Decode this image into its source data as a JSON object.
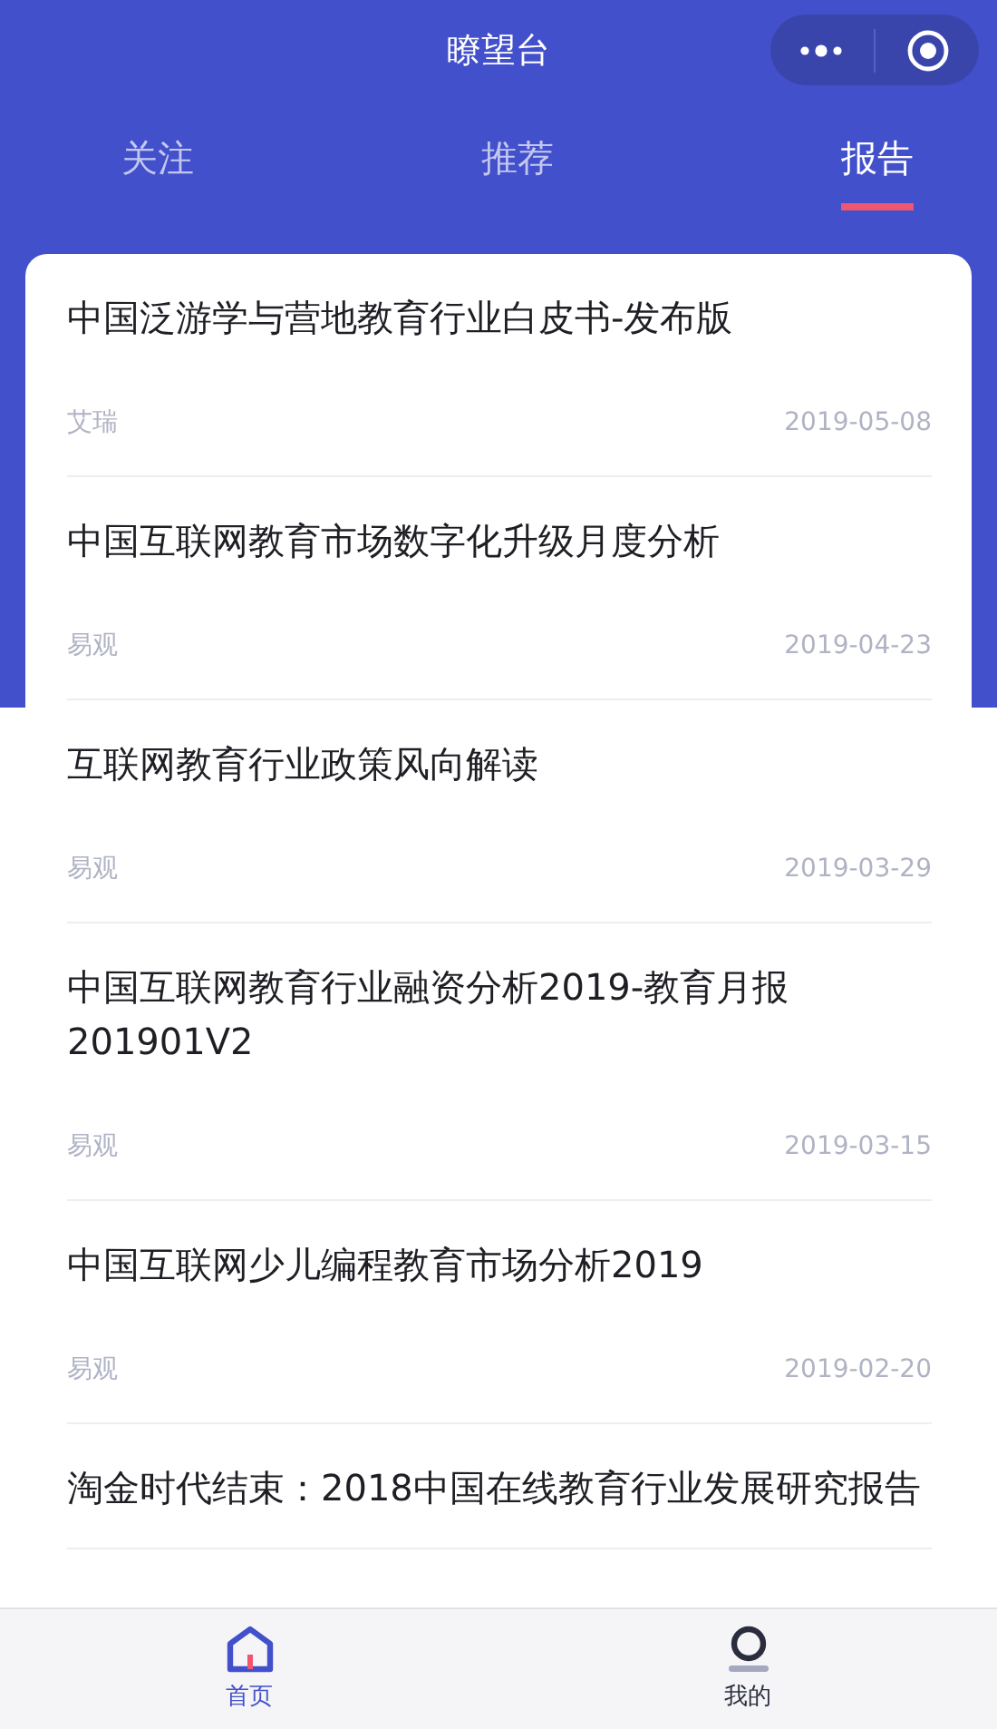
{
  "window": {
    "title": "瞭望台"
  },
  "tabs": [
    {
      "label": "关注",
      "selected": false
    },
    {
      "label": "推荐",
      "selected": false
    },
    {
      "label": "报告",
      "selected": true
    }
  ],
  "reports": [
    {
      "title": "中国泛游学与营地教育行业白皮书-发布版",
      "source": "艾瑞",
      "date": "2019-05-08"
    },
    {
      "title": "中国互联网教育市场数字化升级月度分析",
      "source": "易观",
      "date": "2019-04-23"
    },
    {
      "title": "互联网教育行业政策风向解读",
      "source": "易观",
      "date": "2019-03-29"
    },
    {
      "title": "中国互联网教育行业融资分析2019-教育月报201901V2",
      "source": "易观",
      "date": "2019-03-15"
    },
    {
      "title": "中国互联网少儿编程教育市场分析2019",
      "source": "易观",
      "date": "2019-02-20"
    },
    {
      "title": "淘金时代结束：2018中国在线教育行业发展研究报告"
    }
  ],
  "tab_bar": [
    {
      "label": "首页",
      "kind": "home",
      "selected": true
    },
    {
      "label": "我的",
      "kind": "profile",
      "selected": false
    }
  ]
}
